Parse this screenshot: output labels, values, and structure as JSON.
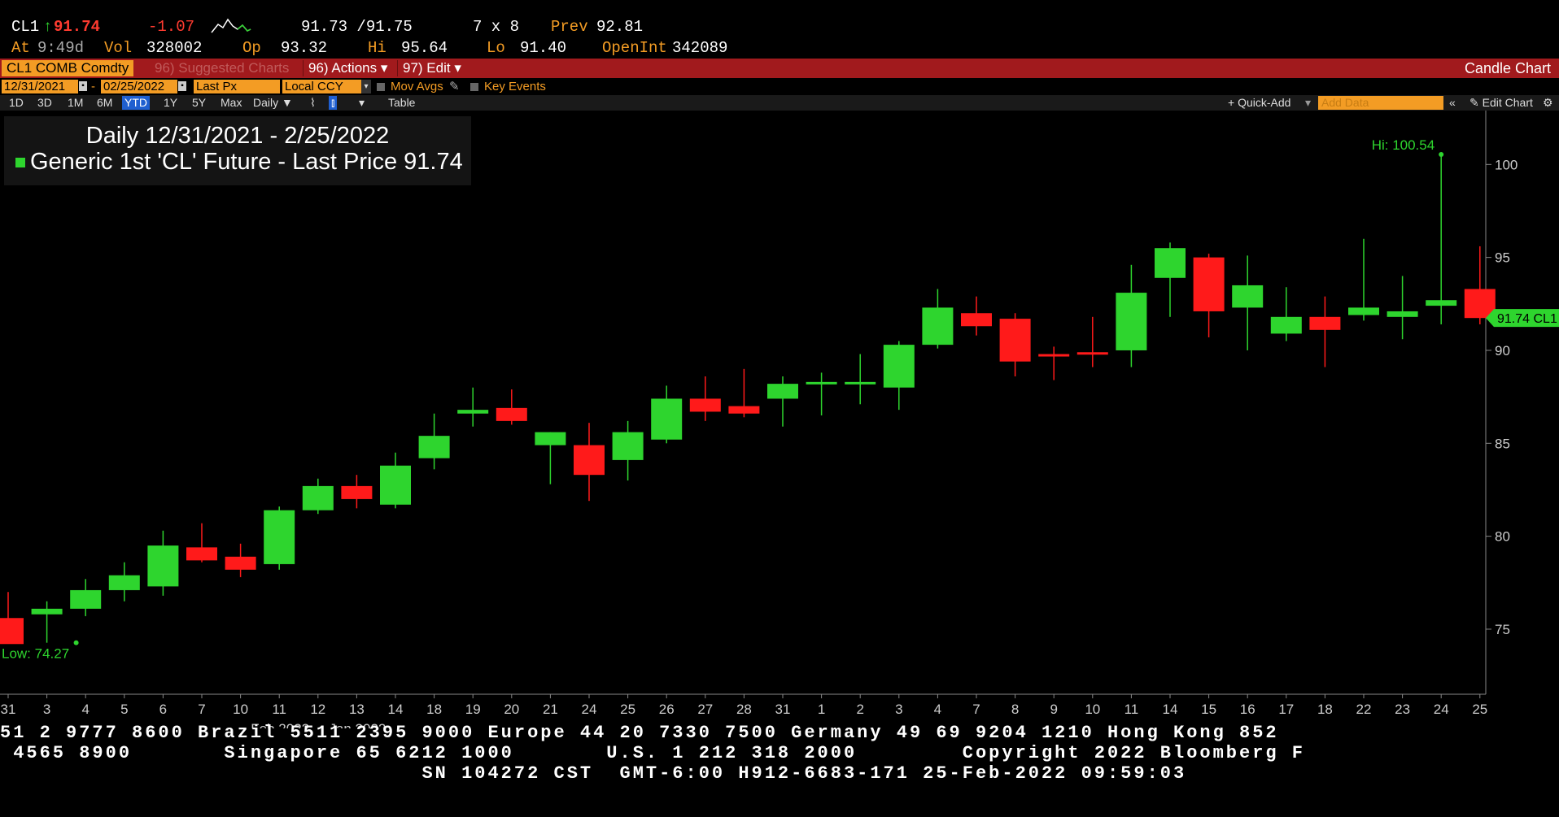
{
  "quote": {
    "ticker": "CL1",
    "arrow": "↑",
    "last": "91.74",
    "change": "-1.07",
    "bid_ask": "91.73 /91.75",
    "size": "7 x 8",
    "prev_label": "Prev",
    "prev": "92.81",
    "at_label": "At",
    "time": "9:49d",
    "vol_label": "Vol",
    "vol": "328002",
    "op_label": "Op",
    "op": "93.32",
    "hi_label": "Hi",
    "hi": "95.64",
    "lo_label": "Lo",
    "lo": "91.40",
    "oi_label": "OpenInt",
    "oi": "342089"
  },
  "function_bar": {
    "security": "CL1 COMB Comdty",
    "suggested": "96) Suggested Charts",
    "actions": "96) Actions",
    "edit": "97) Edit",
    "chart_type": "Candle Chart"
  },
  "options_bar": {
    "start_date": "12/31/2021",
    "end_date": "02/25/2022",
    "field": "Last Px",
    "currency": "Local CCY",
    "mov_avgs": "Mov Avgs",
    "key_events": "Key Events"
  },
  "toolbar": {
    "periods": [
      "1D",
      "3D",
      "1M",
      "6M",
      "YTD",
      "1Y",
      "5Y",
      "Max"
    ],
    "selected_period": "YTD",
    "frequency": "Daily",
    "table": "Table",
    "quick_add": "+ Quick-Add",
    "add_data_placeholder": "Add Data",
    "edit_chart": "Edit Chart"
  },
  "legend": {
    "title": "Daily 12/31/2021 - 2/25/2022",
    "series": "Generic 1st 'CL' Future - Last Price 91.74"
  },
  "colors": {
    "up": "#2ed52e",
    "down": "#ff1a1a",
    "accent": "#f39c24",
    "bar": "#a11a1d"
  },
  "chart_data": {
    "type": "candlestick",
    "x": [
      "31",
      "3",
      "4",
      "5",
      "6",
      "7",
      "10",
      "11",
      "12",
      "13",
      "14",
      "18",
      "19",
      "20",
      "21",
      "24",
      "25",
      "26",
      "27",
      "28",
      "31",
      "1",
      "2",
      "3",
      "4",
      "7",
      "8",
      "9",
      "10",
      "11",
      "14",
      "15",
      "16",
      "17",
      "18",
      "22",
      "23",
      "24",
      "25"
    ],
    "month_labels": [
      {
        "label": "Jan 2022",
        "at": "13"
      },
      {
        "label": "Feb 2022",
        "at": "11"
      }
    ],
    "series": [
      {
        "name": "Generic 1st 'CL' Future - Last Price",
        "open": [
          75.6,
          75.8,
          76.1,
          77.1,
          77.3,
          79.4,
          78.9,
          78.5,
          81.4,
          82.7,
          81.7,
          84.2,
          86.6,
          86.9,
          84.9,
          84.9,
          84.1,
          85.2,
          87.4,
          87.0,
          87.4,
          88.2,
          88.3,
          88.0,
          90.3,
          92.0,
          91.7,
          89.8,
          89.9,
          90.0,
          93.9,
          95.0,
          92.3,
          90.9,
          91.8,
          91.9,
          91.8,
          92.4,
          93.3
        ],
        "high": [
          77.0,
          76.5,
          77.7,
          78.6,
          80.3,
          80.7,
          79.6,
          81.6,
          83.1,
          83.3,
          84.5,
          86.6,
          88.0,
          87.9,
          85.6,
          86.1,
          86.2,
          88.1,
          88.6,
          89.0,
          88.6,
          88.8,
          89.8,
          90.5,
          93.3,
          92.9,
          92.0,
          90.2,
          91.8,
          94.6,
          95.8,
          95.2,
          95.1,
          93.4,
          92.9,
          96.0,
          94.0,
          100.54,
          95.6
        ],
        "low": [
          75.3,
          74.27,
          75.7,
          76.5,
          76.8,
          78.6,
          77.8,
          78.2,
          81.2,
          81.5,
          81.5,
          83.6,
          85.9,
          86.0,
          82.8,
          81.9,
          83.0,
          85.0,
          86.2,
          86.4,
          85.9,
          86.5,
          87.1,
          86.8,
          90.1,
          90.8,
          88.6,
          88.4,
          89.1,
          89.1,
          91.8,
          90.7,
          90.0,
          90.5,
          89.1,
          91.6,
          90.6,
          91.4,
          91.4
        ],
        "close": [
          74.2,
          76.1,
          77.1,
          77.9,
          79.5,
          78.7,
          78.2,
          81.4,
          82.7,
          82.0,
          83.8,
          85.4,
          86.8,
          86.2,
          85.6,
          83.3,
          85.6,
          87.4,
          86.7,
          86.6,
          88.2,
          88.3,
          88.3,
          90.3,
          92.3,
          91.3,
          89.4,
          89.7,
          89.8,
          93.1,
          95.5,
          92.1,
          93.5,
          91.8,
          91.1,
          92.3,
          92.1,
          92.7,
          91.74
        ]
      }
    ],
    "ylim": [
      71.5,
      102.9
    ],
    "yticks": [
      75,
      80,
      85,
      90,
      95,
      100
    ],
    "hi_label": "Hi: 100.54",
    "low_label": "Low: 74.27",
    "last_label": "91.74 CL1",
    "grid": false,
    "legend_position": "top-left"
  },
  "footer": {
    "line1": "51 2 9777 8600 Brazil 5511 2395 9000 Europe 44 20 7330 7500 Germany 49 69 9204 1210 Hong Kong 852",
    "line2": " 4565 8900       Singapore 65 6212 1000       U.S. 1 212 318 2000        Copyright 2022 Bloomberg F",
    "line3": "                                SN 104272 CST  GMT-6:00 H912-6683-171 25-Feb-2022 09:59:03"
  }
}
